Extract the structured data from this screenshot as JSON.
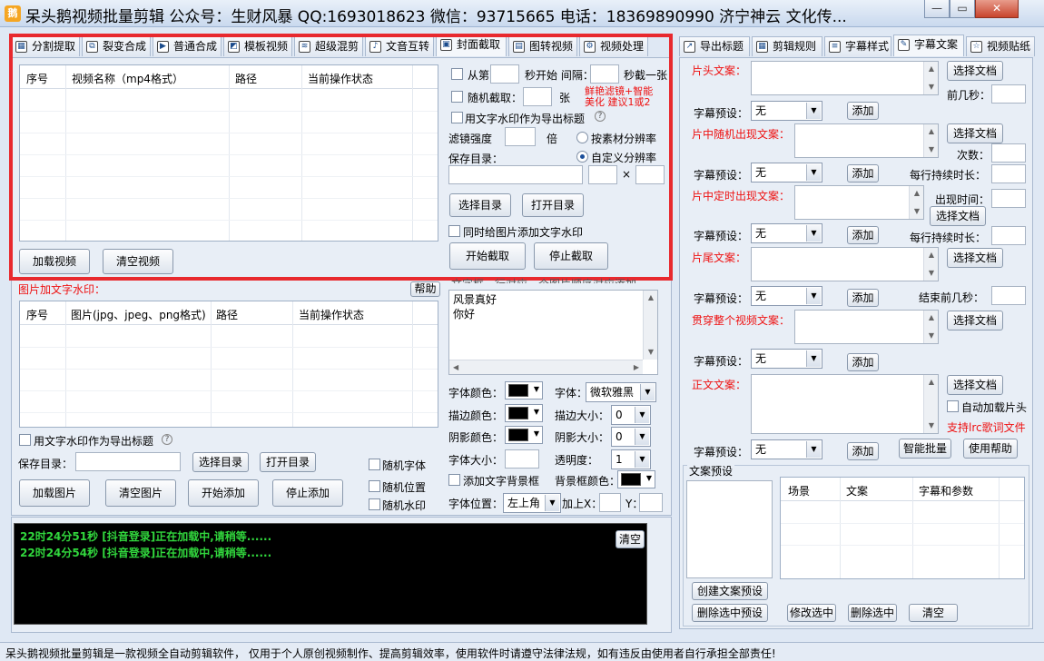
{
  "window": {
    "title": "呆头鹅视频批量剪辑 公众号：生财风暴 QQ:1693018623 微信：93715665 电话：18369890990 济宁神云 文化传...",
    "icon_text": "鹅"
  },
  "left_tabs": [
    "分割提取",
    "裂变合成",
    "普通合成",
    "模板视频",
    "超级混剪",
    "文音互转",
    "封面截取",
    "图转视频",
    "视频处理"
  ],
  "cover": {
    "grid_headers": [
      "序号",
      "视频名称（mp4格式）",
      "路径",
      "当前操作状态"
    ],
    "from_label": "从第",
    "sec_start_label": "秒开始 间隔：",
    "sec_cut_label": "秒截一张",
    "random_label": "随机截取：",
    "random_unit": "张",
    "filter_hint": "鲜艳滤镜+智能美化 建议1或2",
    "watermark_title_label": "用文字水印作为导出标题",
    "filter_label": "滤镜强度",
    "filter_unit": "倍",
    "res_source": "按素材分辨率",
    "res_custom": "自定义分辨率",
    "save_dir_label": "保存目录：",
    "x_sep": "×",
    "choose_dir": "选择目录",
    "open_dir": "打开目录",
    "add_wm_label": "同时给图片添加文字水印",
    "start": "开始截取",
    "stop": "停止截取",
    "load_video": "加载视频",
    "clear_video": "清空视频"
  },
  "watermark": {
    "title": "图片加文字水印：",
    "help": "帮助",
    "hint": "文字框一行对应一个图片顺序对应添加",
    "text_lines": "风景真好\n你好",
    "grid_headers": [
      "序号",
      "图片(jpg、jpeg、png格式)",
      "路径",
      "当前操作状态"
    ],
    "font_color": "字体颜色：",
    "font_label": "字体：",
    "font_value": "微软雅黑",
    "stroke_color": "描边颜色：",
    "stroke_size": "描边大小：",
    "stroke_size_value": "0",
    "shadow_color": "阴影颜色：",
    "shadow_size": "阴影大小：",
    "shadow_size_value": "0",
    "font_size": "字体大小：",
    "opacity": "透明度：",
    "opacity_value": "1",
    "add_bg": "添加文字背景框",
    "bg_color": "背景框颜色：",
    "position_label": "字体位置：",
    "position_value": "左上角",
    "add_x": "加上X：",
    "y_label": "Y：",
    "as_title": "用文字水印作为导出标题",
    "save_dir": "保存目录：",
    "choose_dir": "选择目录",
    "open_dir": "打开目录",
    "random_font": "随机字体",
    "random_pos": "随机位置",
    "random_wm": "随机水印",
    "load_img": "加载图片",
    "clear_img": "清空图片",
    "start_add": "开始添加",
    "stop_add": "停止添加"
  },
  "log": {
    "lines": [
      "22时24分51秒 [抖音登录]正在加载中,请稍等......",
      "22时24分54秒 [抖音登录]正在加载中,请稍等......"
    ],
    "clear": "清空"
  },
  "right_tabs": [
    "导出标题",
    "剪辑规则",
    "字幕样式",
    "字幕文案",
    "视频贴纸"
  ],
  "subtitle": {
    "head": "片头文案：",
    "mid_random": "片中随机出现文案：",
    "mid_fixed": "片中定时出现文案：",
    "tail": "片尾文案：",
    "through": "贯穿整个视频文案：",
    "body": "正文文案：",
    "choose_doc": "选择文档",
    "preset_label": "字幕预设：",
    "preset_value": "无",
    "add": "添加",
    "first_sec": "前几秒：",
    "count": "次数：",
    "line_duration": "每行持续时长：",
    "appear_time": "出现时间：",
    "end_before": "结束前几秒：",
    "auto_load": "自动加载片头",
    "support_lrc": "支持lrc歌词文件",
    "smart_batch": "智能批量",
    "help": "使用帮助",
    "preset_section": "文案预设",
    "preset_headers": [
      "场景",
      "文案",
      "字幕和参数"
    ],
    "create_preset": "创建文案预设",
    "delete_preset": "删除选中预设",
    "modify": "修改选中",
    "delete_sel": "删除选中",
    "clear": "清空"
  },
  "status": "呆头鹅视频批量剪辑是一款视频全自动剪辑软件， 仅用于个人原创视频制作、提高剪辑效率，使用软件时请遵守法律法规，如有违反由使用者自行承担全部责任!",
  "colors": {
    "highlight": "#e8292e",
    "log_text": "#31d63d",
    "red_label": "#e11"
  }
}
